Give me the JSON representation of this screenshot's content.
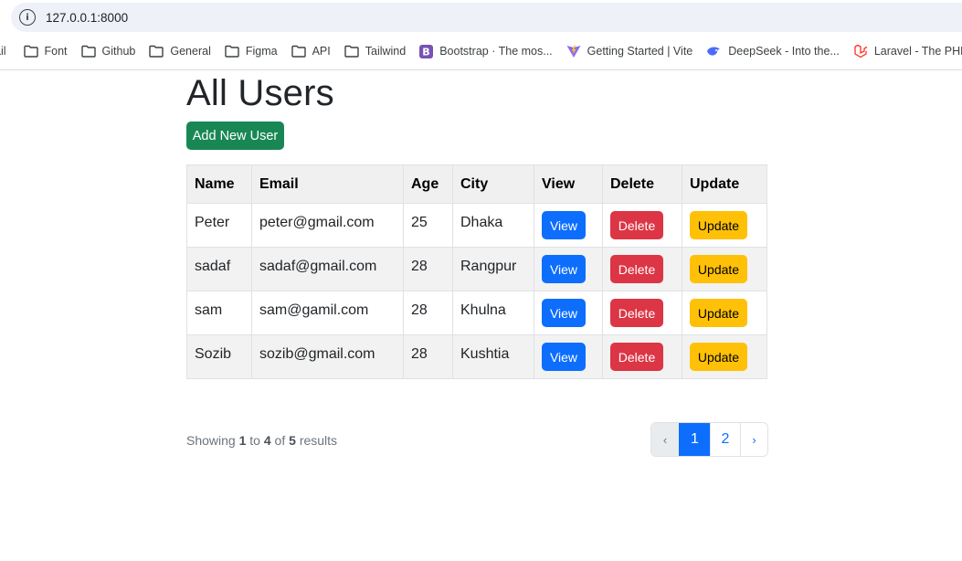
{
  "browser": {
    "url": "127.0.0.1:8000",
    "bookmarks": [
      {
        "label": "ail",
        "icon": "none"
      },
      {
        "label": "Font",
        "icon": "folder-icon"
      },
      {
        "label": "Github",
        "icon": "folder-icon"
      },
      {
        "label": "General",
        "icon": "folder-icon"
      },
      {
        "label": "Figma",
        "icon": "folder-icon"
      },
      {
        "label": "API",
        "icon": "folder-icon"
      },
      {
        "label": "Tailwind",
        "icon": "folder-icon"
      },
      {
        "label": "Bootstrap · The mos...",
        "icon": "bootstrap-icon"
      },
      {
        "label": "Getting Started | Vite",
        "icon": "vite-icon"
      },
      {
        "label": "DeepSeek - Into the...",
        "icon": "deepseek-icon"
      },
      {
        "label": "Laravel - The PHP F",
        "icon": "laravel-icon"
      }
    ]
  },
  "page": {
    "title": "All Users",
    "add_button": "Add New User"
  },
  "table": {
    "headers": [
      "Name",
      "Email",
      "Age",
      "City",
      "View",
      "Delete",
      "Update"
    ],
    "rows": [
      {
        "name": "Peter",
        "email": "peter@gmail.com",
        "age": "25",
        "city": "Dhaka"
      },
      {
        "name": "sadaf",
        "email": "sadaf@gmail.com",
        "age": "28",
        "city": "Rangpur"
      },
      {
        "name": "sam",
        "email": "sam@gamil.com",
        "age": "28",
        "city": "Khulna"
      },
      {
        "name": "Sozib",
        "email": "sozib@gmail.com",
        "age": "28",
        "city": "Kushtia"
      }
    ],
    "view_label": "View",
    "delete_label": "Delete",
    "update_label": "Update"
  },
  "pagination": {
    "showing_prefix": "Showing",
    "from": "1",
    "to_word": "to",
    "to": "4",
    "of_word": "of",
    "total": "5",
    "results_word": "results",
    "prev": "‹",
    "pages": [
      "1",
      "2"
    ],
    "active_page": "1",
    "next": "›"
  },
  "colors": {
    "success": "#198754",
    "primary": "#0d6efd",
    "danger": "#dc3545",
    "warning": "#ffc107"
  }
}
